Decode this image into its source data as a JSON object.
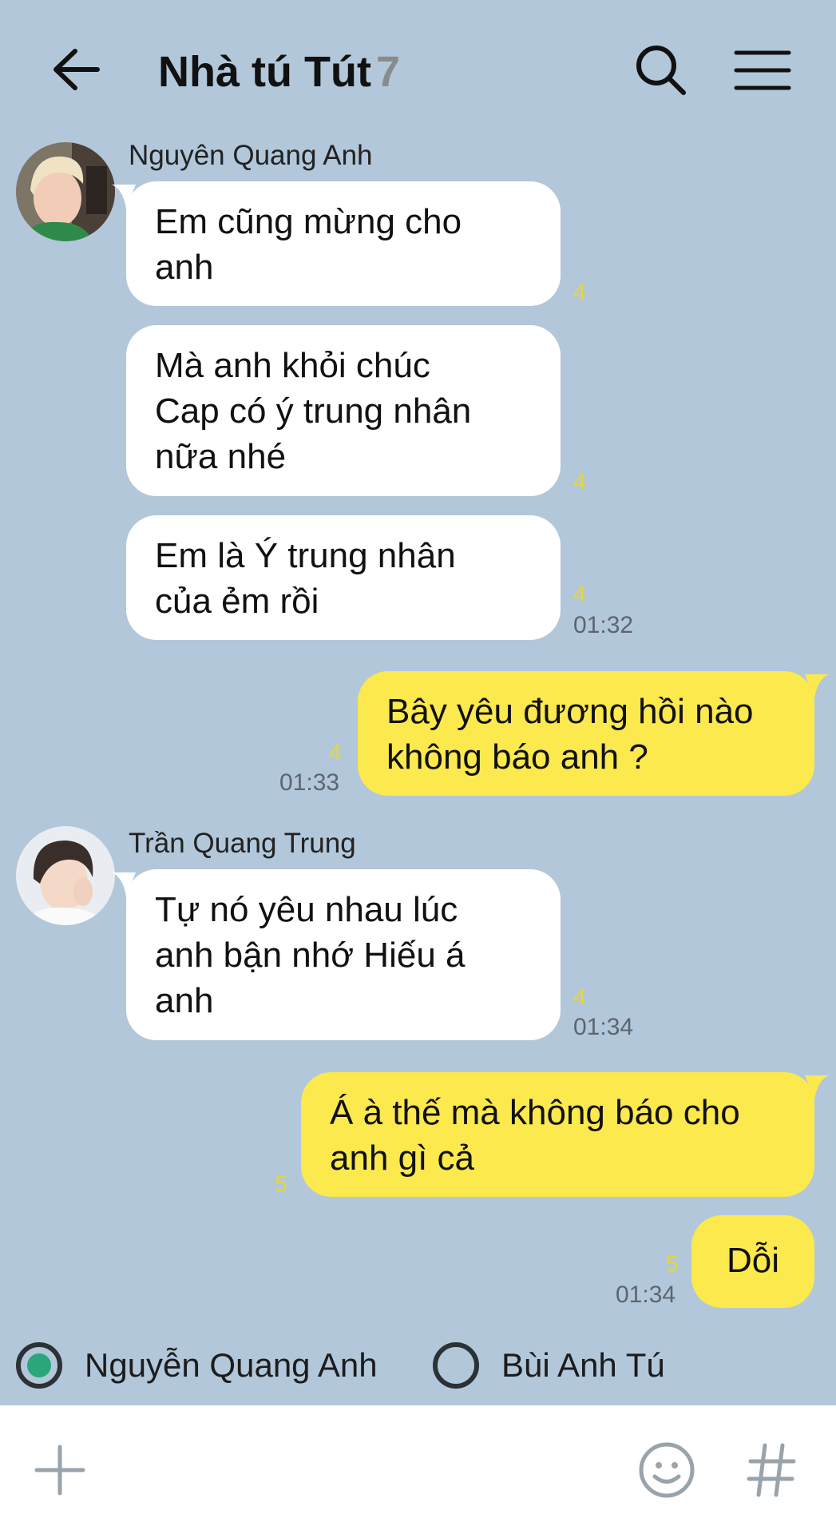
{
  "header": {
    "title": "Nhà tú Tút",
    "member_count": "7",
    "back_icon": "arrow-left-icon",
    "search_icon": "search-icon",
    "menu_icon": "hamburger-menu-icon"
  },
  "messages": [
    {
      "sender": "Nguyên Quang Anh",
      "text_lines": [
        "Em cũng mừng cho",
        "anh"
      ],
      "unread": "4",
      "time": ""
    },
    {
      "text_lines": [
        "Mà anh khỏi chúc",
        "Cap có ý trung nhân",
        "nữa nhé"
      ],
      "unread": "4",
      "time": ""
    },
    {
      "text_lines": [
        "Em là Ý trung nhân",
        "của ẻm rồi"
      ],
      "unread": "4",
      "time": "01:32"
    },
    {
      "mine": true,
      "text_lines": [
        "Bây yêu đương hồi nào",
        "không báo anh ?"
      ],
      "unread": "4",
      "time": "01:33"
    },
    {
      "sender": "Trần Quang Trung",
      "text_lines": [
        "Tự nó yêu nhau lúc",
        "anh bận nhớ Hiếu á",
        "anh"
      ],
      "unread": "4",
      "time": "01:34"
    },
    {
      "mine": true,
      "text_lines": [
        "Á à thế mà không báo cho",
        "anh gì cả"
      ],
      "unread": "5",
      "time": ""
    },
    {
      "mine": true,
      "text_lines": [
        "Dỗi"
      ],
      "unread": "5",
      "time": "01:34"
    }
  ],
  "selector": {
    "options": [
      {
        "label": "Nguyễn Quang Anh",
        "selected": true
      },
      {
        "label": "Bùi Anh Tú",
        "selected": false
      }
    ]
  },
  "input_bar": {
    "add_icon": "plus-icon",
    "emoji_icon": "emoji-icon",
    "hashtag_icon": "hashtag-icon"
  },
  "colors": {
    "background": "#b2c7da",
    "my_bubble": "#fbe94d",
    "their_bubble": "#ffffff",
    "unread_count": "#e5d63a",
    "radio_selected": "#2aa67a"
  }
}
